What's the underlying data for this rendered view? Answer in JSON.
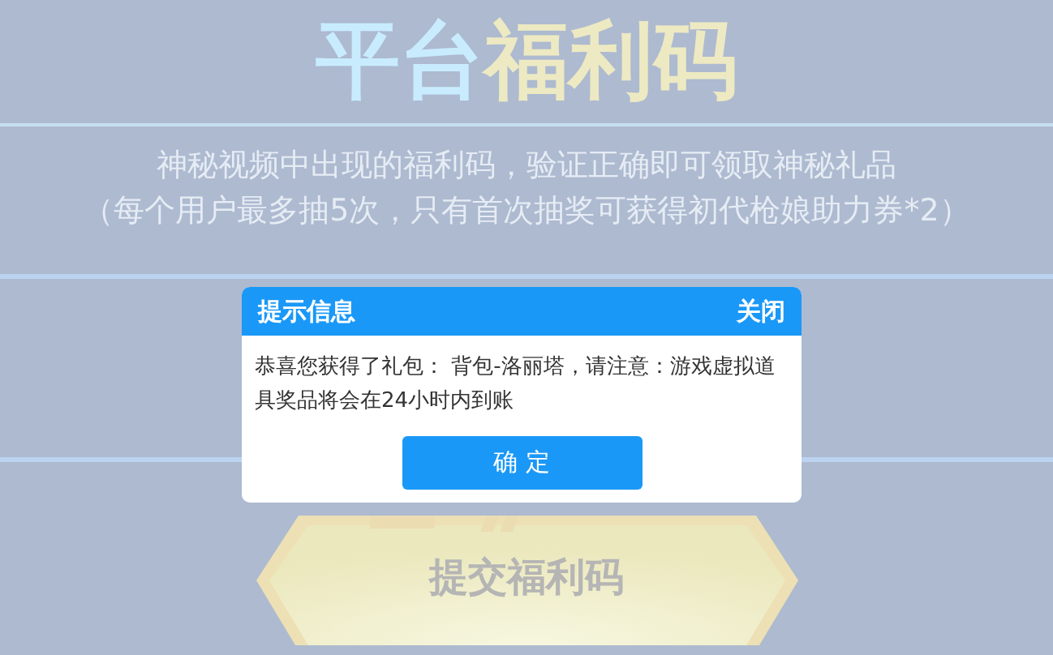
{
  "title": {
    "part_1": "平台",
    "part_2": "福利码"
  },
  "subtitle": [
    "神秘视频中出现的福利码，验证正确即可领取神秘礼品",
    "（每个用户最多抽5次，只有首次抽奖可获得初代枪娘助力券*2）"
  ],
  "dialog": {
    "title": "提示信息",
    "close": "关闭",
    "message": "恭喜您获得了礼包： 背包-洛丽塔，请注意：游戏虚拟道具奖品将会在24小时内到账",
    "confirm": "确 定"
  },
  "submit_button": {
    "label": "提交福利码"
  }
}
